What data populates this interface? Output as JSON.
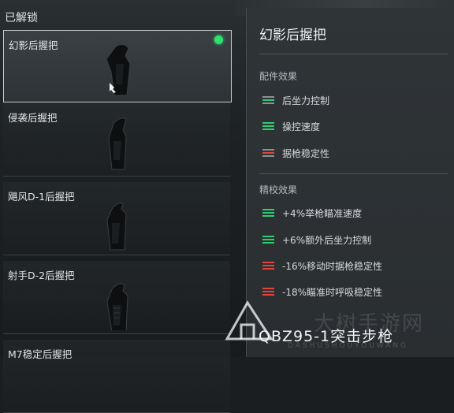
{
  "section_title": "已解锁",
  "items": [
    {
      "name": "幻影后握把",
      "equipped": true
    },
    {
      "name": "侵袭后握把",
      "equipped": false
    },
    {
      "name": "飓风D-1后握把",
      "equipped": false
    },
    {
      "name": "射手D-2后握把",
      "equipped": false
    },
    {
      "name": "M7稳定后握把",
      "equipped": false
    }
  ],
  "panel": {
    "title": "幻影后握把",
    "effects_title": "配件效果",
    "effects": [
      {
        "label": "后坐力控制",
        "indicator": "neutral"
      },
      {
        "label": "操控速度",
        "indicator": "positive"
      },
      {
        "label": "据枪稳定性",
        "indicator": "neutral-negative"
      }
    ],
    "tuning_title": "精校效果",
    "tuning": [
      {
        "label": "+4%举枪瞄准速度",
        "indicator": "positive"
      },
      {
        "label": "+6%额外后坐力控制",
        "indicator": "positive"
      },
      {
        "label": "-16%移动时据枪稳定性",
        "indicator": "negative"
      },
      {
        "label": "-18%瞄准时呼吸稳定性",
        "indicator": "negative"
      }
    ]
  },
  "weapon_name": "QBZ95-1突击步枪",
  "watermark": {
    "text": "大树手游网",
    "sub": "DASHUSHOUYOUWANG"
  },
  "colors": {
    "positive": "#2ecc71",
    "negative": "#e0453c",
    "neutral": "#8b9195",
    "equipped": "#2ee06c"
  }
}
